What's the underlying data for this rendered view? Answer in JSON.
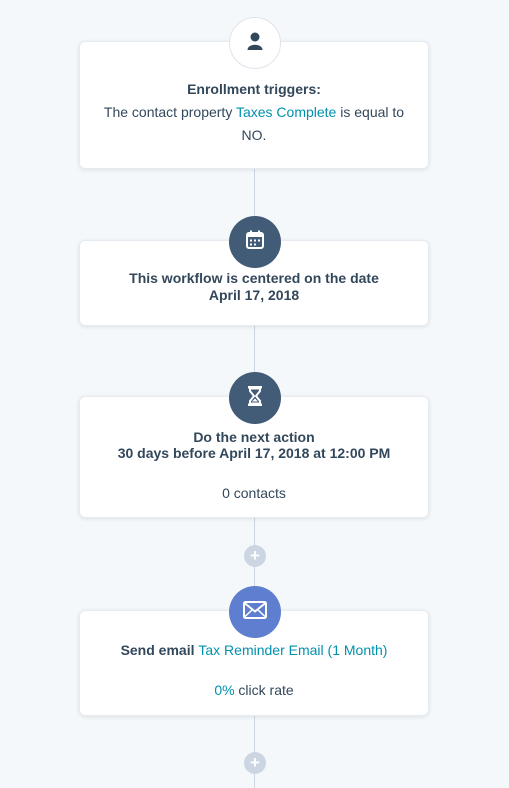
{
  "trigger_card": {
    "title": "Enrollment triggers:",
    "line_prefix": "The contact property ",
    "property_name": "Taxes Complete",
    "line_suffix": " is equal to",
    "value": "NO."
  },
  "date_card": {
    "line1": "This workflow is centered on the date",
    "line2": "April 17, 2018"
  },
  "delay_card": {
    "line1": "Do the next action",
    "line2": "30 days before April 17, 2018 at 12:00 PM",
    "contacts": "0 contacts"
  },
  "email_card": {
    "action_label": "Send email ",
    "email_name": "Tax Reminder Email (1 Month)",
    "click_rate_value": "0%",
    "click_rate_label": " click rate"
  },
  "plus_buttons": [
    "+",
    "+"
  ],
  "icons": {
    "trigger": "user-icon",
    "date": "calendar-icon",
    "delay": "hourglass-icon",
    "email": "envelope-icon"
  },
  "colors": {
    "background": "#f5f8fa",
    "link": "#0091ae",
    "dark_badge": "#425b76",
    "email_badge": "#5e7fcf",
    "connector": "#cbd6e2"
  }
}
